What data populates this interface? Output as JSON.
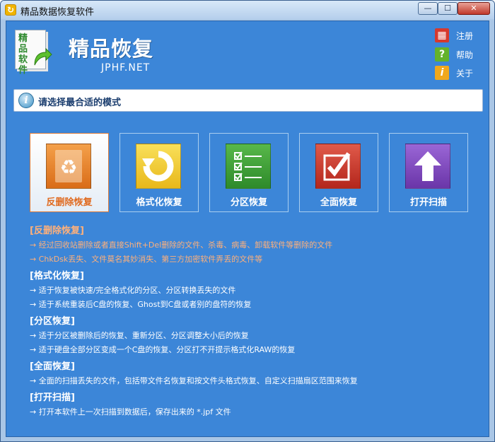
{
  "window": {
    "title": "精品数据恢复软件",
    "min_glyph": "—",
    "max_glyph": "☐",
    "close_glyph": "✕"
  },
  "brand": {
    "title": "精品恢复",
    "subtitle": "JPHF.NET",
    "logo_text": "精品软件"
  },
  "top_links": [
    {
      "label": "注册",
      "icon": "cart-icon",
      "color": "#d6392d",
      "glyph": "▦"
    },
    {
      "label": "帮助",
      "icon": "help-icon",
      "color": "#64b22b",
      "glyph": "?"
    },
    {
      "label": "关于",
      "icon": "info-icon",
      "color": "#f0a81c",
      "glyph": "i"
    }
  ],
  "mode_bar": {
    "text": "请选择最合适的模式"
  },
  "modes": [
    {
      "label": "反删除恢复",
      "icon": "recycle-icon",
      "color": "#e8842a",
      "active": true,
      "glyph": "♻"
    },
    {
      "label": "格式化恢复",
      "icon": "rotate-arrow-icon",
      "color": "#f3cf2c",
      "active": false,
      "glyph": "↻"
    },
    {
      "label": "分区恢复",
      "icon": "checklist-icon",
      "color": "#3b9e35",
      "active": false,
      "glyph": "☑"
    },
    {
      "label": "全面恢复",
      "icon": "checkmark-icon",
      "color": "#c9342a",
      "active": false,
      "glyph": "✔"
    },
    {
      "label": "打开扫描",
      "icon": "upload-arrow-icon",
      "color": "#7a45b9",
      "active": false,
      "glyph": "⇧"
    }
  ],
  "descriptions": [
    {
      "title": "[反删除恢复]",
      "lines": [
        "→ 经过回收站删除或者直接Shift+Del删除的文件、杀毒、病毒、卸载软件等删除的文件",
        "→ ChkDsk丢失、文件莫名其妙消失、第三方加密软件弄丢的文件等"
      ],
      "highlight": true
    },
    {
      "title": "[格式化恢复]",
      "lines": [
        "→ 适于恢复被快速/完全格式化的分区、分区转换丢失的文件",
        "→ 适于系统重装后C盘的恢复、Ghost到C盘或者别的盘符的恢复"
      ],
      "highlight": false
    },
    {
      "title": "[分区恢复]",
      "lines": [
        "→ 适于分区被删除后的恢复、重新分区、分区调整大小后的恢复",
        "→ 适于硬盘全部分区变成一个C盘的恢复、分区打不开提示格式化RAW的恢复"
      ],
      "highlight": false
    },
    {
      "title": "[全面恢复]",
      "lines": [
        "→ 全面的扫描丢失的文件，包括带文件名恢复和按文件头格式恢复、自定义扫描扇区范围来恢复"
      ],
      "highlight": false
    },
    {
      "title": "[打开扫描]",
      "lines": [
        "→ 打开本软件上一次扫描到数据后，保存出来的 *.jpf 文件"
      ],
      "highlight": false
    }
  ]
}
